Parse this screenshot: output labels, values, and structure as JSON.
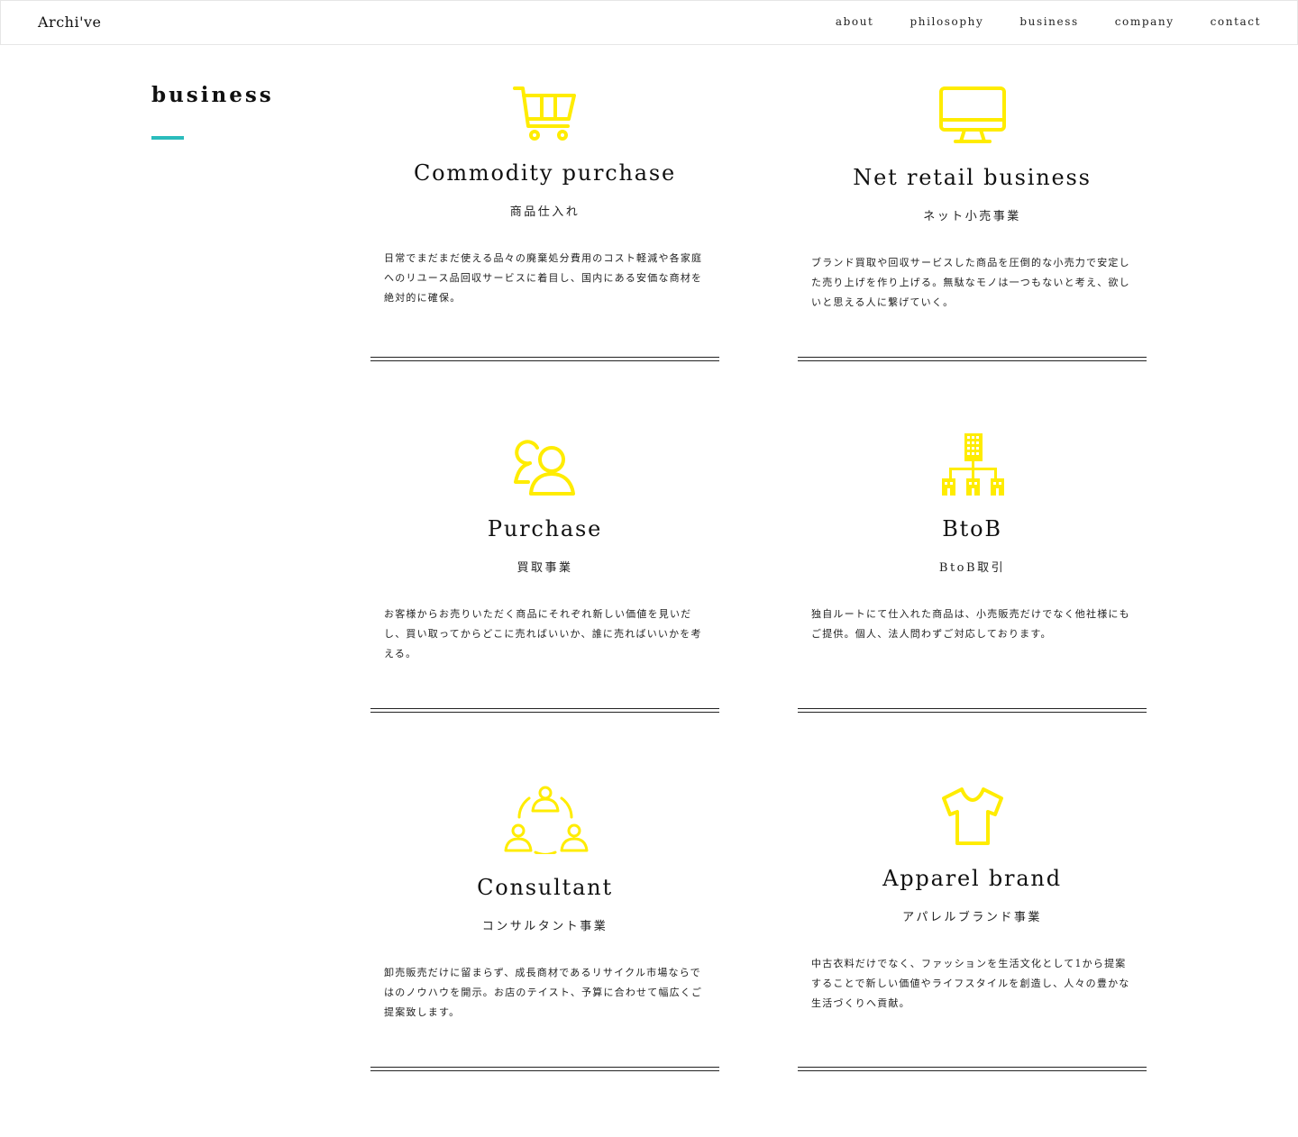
{
  "header": {
    "logo": "Archi've",
    "nav": [
      "about",
      "philosophy",
      "business",
      "company",
      "contact"
    ]
  },
  "section": {
    "title": "business",
    "accent_color": "#2bbcbc"
  },
  "icon_color": "#ffec00",
  "cards": [
    {
      "icon": "shopping-cart-icon",
      "title": "Commodity purchase",
      "subtitle": "商品仕入れ",
      "description": "日常でまだまだ使える品々の廃棄処分費用のコスト軽減や各家庭へのリユース品回収サービスに着目し、国内にある安価な商材を絶対的に確保。"
    },
    {
      "icon": "monitor-icon",
      "title": "Net retail business",
      "subtitle": "ネット小売事業",
      "description": "ブランド買取や回収サービスした商品を圧倒的な小売力で安定した売り上げを作り上げる。無駄なモノは一つもないと考え、欲しいと思える人に繋げていく。"
    },
    {
      "icon": "users-icon",
      "title": "Purchase",
      "subtitle": "買取事業",
      "description": "お客様からお売りいただく商品にそれぞれ新しい価値を見いだし、買い取ってからどこに売ればいいか、誰に売ればいいかを考える。"
    },
    {
      "icon": "buildings-network-icon",
      "title": "BtoB",
      "subtitle": "BtoB取引",
      "description": "独自ルートにて仕入れた商品は、小売販売だけでなく他社様にもご提供。個人、法人問わずご対応しております。"
    },
    {
      "icon": "people-cycle-icon",
      "title": "Consultant",
      "subtitle": "コンサルタント事業",
      "description": "卸売販売だけに留まらず、成長商材であるリサイクル市場ならではのノウハウを開示。お店のテイスト、予算に合わせて幅広くご提案致します。"
    },
    {
      "icon": "tshirt-icon",
      "title": "Apparel brand",
      "subtitle": "アパレルブランド事業",
      "description": "中古衣料だけでなく、ファッションを生活文化として1から提案することで新しい価値やライフスタイルを創造し、人々の豊かな生活づくりへ貢献。"
    }
  ]
}
